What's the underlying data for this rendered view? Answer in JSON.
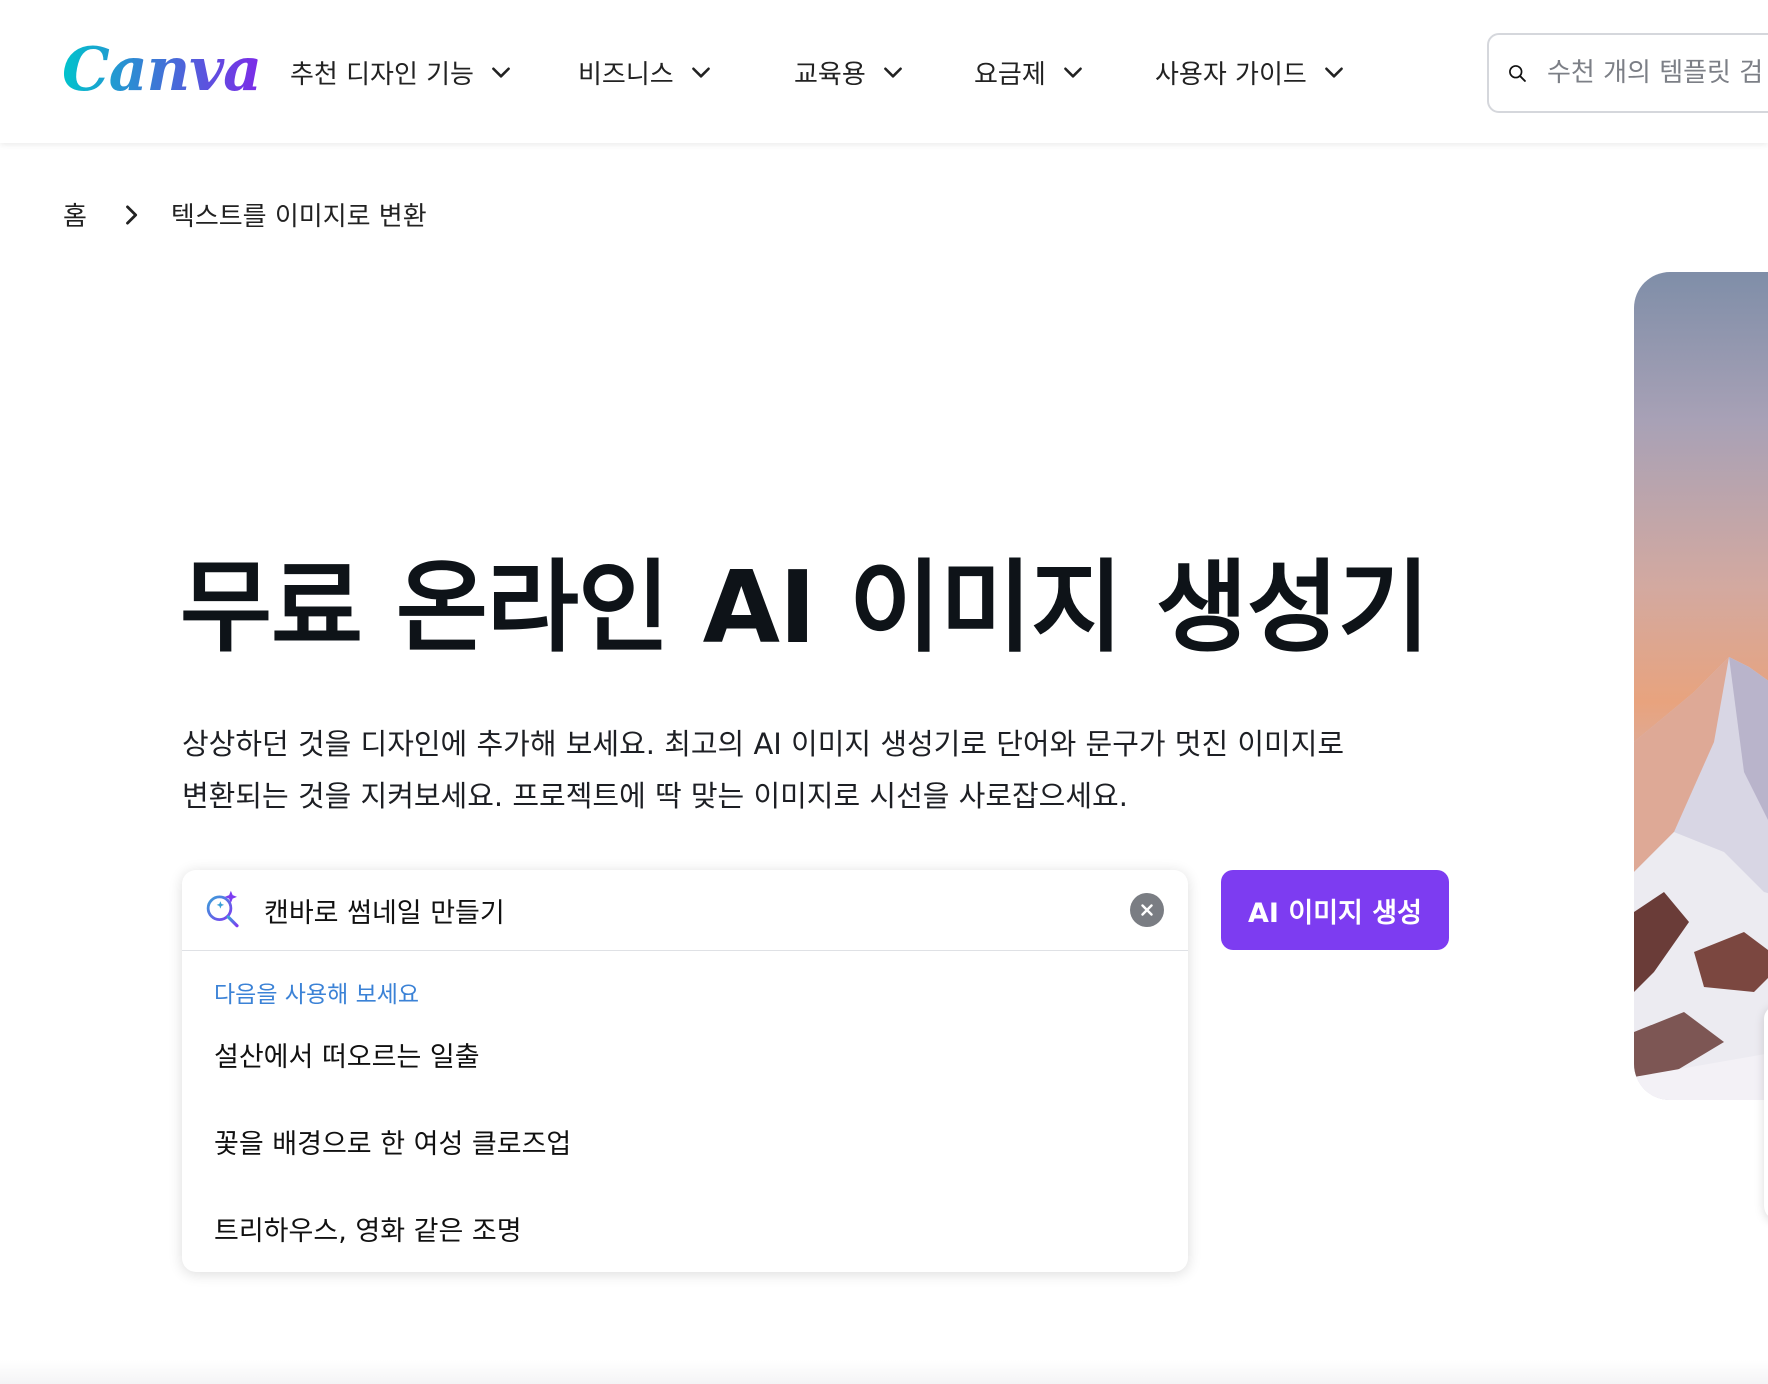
{
  "header": {
    "logo_text": "Canva",
    "nav": [
      {
        "label": "추천 디자인 기능"
      },
      {
        "label": "비즈니스"
      },
      {
        "label": "교육용"
      },
      {
        "label": "요금제"
      },
      {
        "label": "사용자 가이드"
      }
    ],
    "search": {
      "placeholder": "수천 개의 템플릿 검"
    }
  },
  "breadcrumb": {
    "home": "홈",
    "current": "텍스트를 이미지로 변환"
  },
  "hero": {
    "title": "무료 온라인 AI 이미지 생성기",
    "description_line1": "상상하던 것을 디자인에 추가해 보세요. 최고의 AI 이미지 생성기로 단어와 문구가 멋진 이미지로",
    "description_line2": "변환되는 것을 지켜보세요. 프로젝트에 딱 맞는 이미지로 시선을 사로잡으세요."
  },
  "prompt": {
    "value": "캔바로 썸네일 만들기",
    "suggestions_heading": "다음을 사용해 보세요",
    "suggestions": [
      "설산에서 떠오르는 일출",
      "꽃을 배경으로 한 여성 클로즈업",
      "트리하우스, 영화 같은 조명"
    ],
    "generate_label": "AI 이미지 생성"
  },
  "colors": {
    "accent": "#7d3cf1",
    "suggest_heading": "#3b82d6",
    "text": "#0e1318"
  },
  "icons": {
    "search": "search-icon",
    "ai_search": "magic-search-icon",
    "clear": "clear-icon",
    "chevron": "chevron-down-icon",
    "breadcrumb_sep": "chevron-right-icon"
  }
}
